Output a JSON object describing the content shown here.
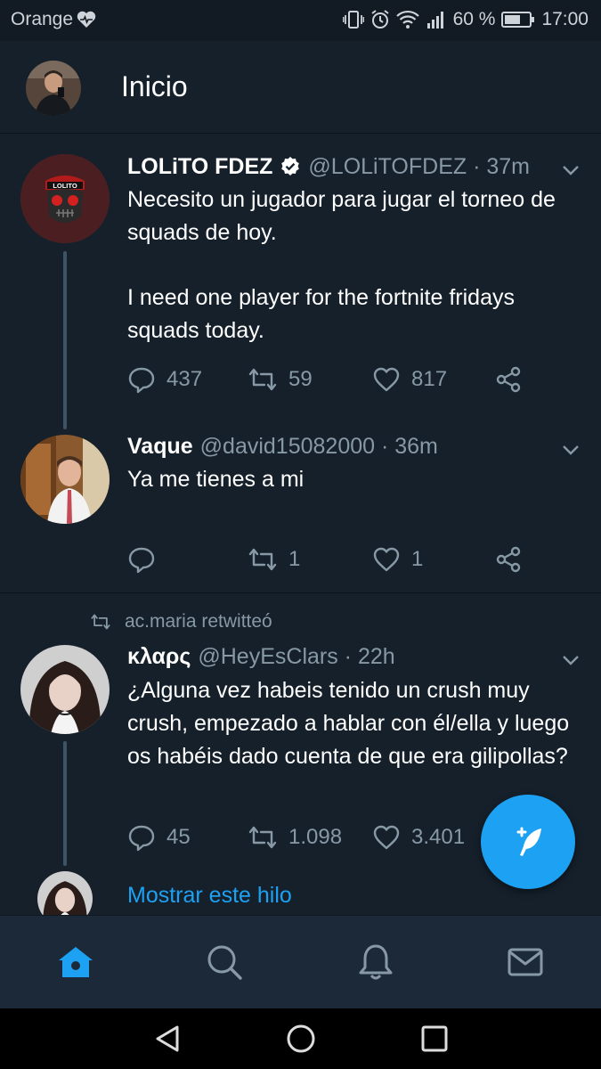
{
  "status_bar": {
    "carrier": "Orange",
    "battery": "60 %",
    "time": "17:00"
  },
  "header": {
    "title": "Inicio"
  },
  "tweets": [
    {
      "name": "LOLiTO FDEZ",
      "verified": true,
      "handle": "@LOLiTOFDEZ",
      "time": "37m",
      "text": [
        "Necesito un jugador para jugar el torneo de squads de hoy.",
        "I need one player for the fortnite fridays squads today."
      ],
      "replies": "437",
      "retweets": "59",
      "likes": "817",
      "avatar_text": "LOLITO"
    },
    {
      "name": "Vaque",
      "verified": false,
      "handle": "@david15082000",
      "time": "36m",
      "text": [
        "Ya me tienes a mi"
      ],
      "replies": "",
      "retweets": "1",
      "likes": "1"
    },
    {
      "retweeted_by": "ac.maria retwitteó",
      "name": "κλαρς",
      "verified": false,
      "handle": "@HeyEsClars",
      "time": "22h",
      "text": [
        "¿Alguna vez habeis tenido un crush muy crush, empezado a hablar con él/ella y luego os habéis dado cuenta de que era gilipollas?"
      ],
      "replies": "45",
      "retweets": "1.098",
      "likes": "3.401"
    }
  ],
  "show_thread": "Mostrar este hilo",
  "tabs": [
    "home-icon",
    "search-icon",
    "bell-icon",
    "mail-icon"
  ],
  "colors": {
    "background": "#15202b",
    "accent": "#1da1f2",
    "secondary_text": "#8899a6",
    "tabbar": "#1c2938"
  }
}
